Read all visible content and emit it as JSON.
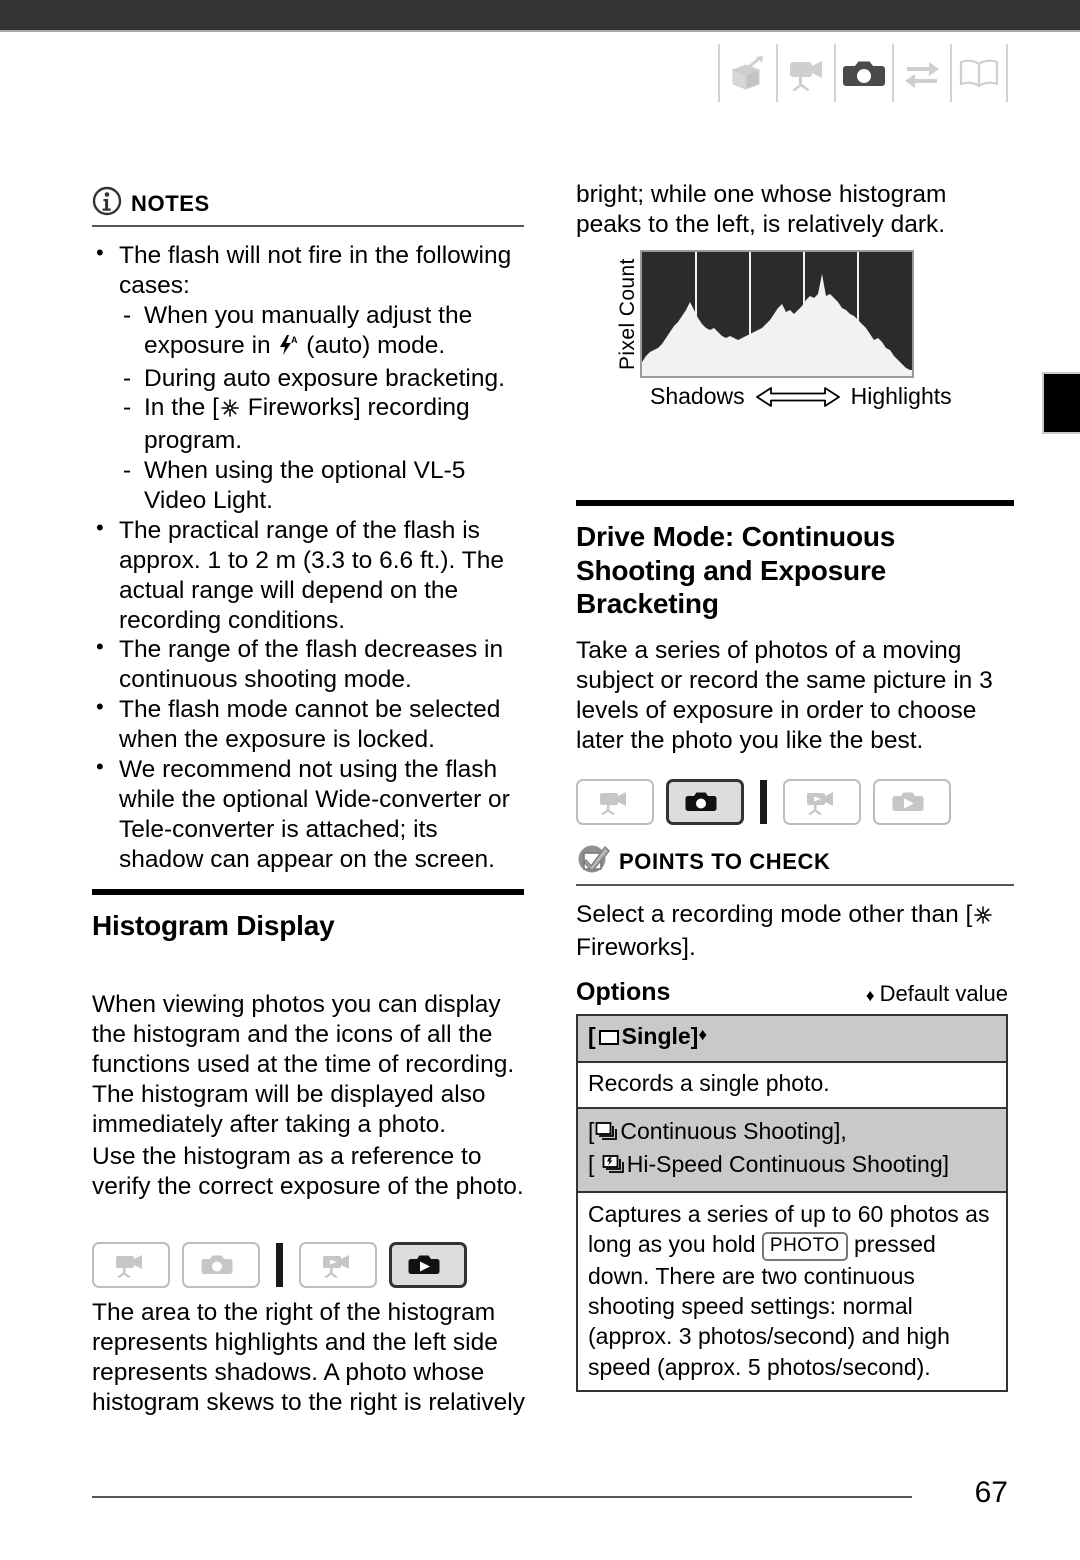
{
  "page": {
    "number": "67",
    "edge_tab": "chapter-tab-marker"
  },
  "header": {
    "icons": [
      {
        "name": "box-open-arrow-icon",
        "state": "inactive"
      },
      {
        "name": "video-camera-icon",
        "state": "inactive"
      },
      {
        "name": "photo-camera-icon",
        "state": "active"
      },
      {
        "name": "exchange-arrows-icon",
        "state": "inactive"
      },
      {
        "name": "open-book-icon",
        "state": "inactive"
      }
    ]
  },
  "left_column": {
    "notes": {
      "icon": "info-circle-icon",
      "title": "NOTES",
      "bullets": [
        {
          "text": "The flash will not fire in the following cases:",
          "sub": [
            {
              "pre": "When you manually adjust the exposure in ",
              "icon": "flash-auto-icon",
              "post": " (auto) mode."
            },
            {
              "pre": "During auto exposure bracketing.",
              "icon": "",
              "post": ""
            },
            {
              "pre": "In the [",
              "icon": "fireworks-icon",
              "post": " Fireworks] recording program."
            },
            {
              "pre": "When using the optional VL-5 Video Light.",
              "icon": "",
              "post": ""
            }
          ]
        },
        {
          "text": "The practical range of the flash is approx. 1 to 2 m (3.3 to 6.6 ft.). The actual range will depend on the recording conditions.",
          "sub": []
        },
        {
          "text": "The range of the flash decreases in continuous shooting mode.",
          "sub": []
        },
        {
          "text": "The flash mode cannot be selected when the exposure is locked.",
          "sub": []
        },
        {
          "text": "We recommend not using the flash while the optional Wide-converter or Tele-converter is attached; its shadow can appear on the screen.",
          "sub": []
        }
      ]
    },
    "histogram_section": {
      "title": "Histogram Display",
      "paragraph_1": "When viewing photos you can display the histogram and the icons of all the functions used at the time of recording. The histogram will be displayed also immediately after taking a photo.",
      "paragraph_2": "Use the histogram as a reference to verify the correct exposure of the photo.",
      "mode_buttons": [
        {
          "name": "movie-record-mode-button",
          "icon": "video-camera-icon",
          "active": false
        },
        {
          "name": "photo-record-mode-button",
          "icon": "photo-camera-icon",
          "active": false
        },
        {
          "name": "movie-playback-mode-button",
          "icon": "video-playback-icon",
          "active": false
        },
        {
          "name": "photo-playback-mode-button",
          "icon": "photo-playback-icon",
          "active": true
        }
      ],
      "paragraph_3": "The area to the right of the histogram represents highlights and the left side represents shadows. A photo whose histogram skews to the right is relatively"
    }
  },
  "right_column": {
    "continued_text": "bright; while one whose histogram peaks to the left, is relatively dark.",
    "histogram_figure": {
      "y_label": "Pixel Count",
      "left_label": "Shadows",
      "right_label": "Highlights",
      "arrow": "double-arrow-icon"
    },
    "drive_mode_section": {
      "title": "Drive Mode: Continuous Shooting and Exposure Bracketing",
      "intro": "Take a series of photos of a moving subject or record the same picture in 3 levels of exposure in order to choose later the photo you like the best.",
      "mode_buttons": [
        {
          "name": "movie-record-mode-button",
          "icon": "video-camera-icon",
          "active": false
        },
        {
          "name": "photo-record-mode-button",
          "icon": "photo-camera-icon",
          "active": true
        },
        {
          "name": "movie-playback-mode-button",
          "icon": "video-playback-icon",
          "active": false
        },
        {
          "name": "photo-playback-mode-button",
          "icon": "photo-playback-icon",
          "active": false
        }
      ],
      "points_to_check": {
        "icon": "checkbox-check-icon",
        "title": "POINTS TO CHECK",
        "text_pre": "Select a recording mode other than [",
        "text_icon": "fireworks-icon",
        "text_post": " Fireworks]."
      },
      "options": {
        "label": "Options",
        "default_marker": "♦",
        "default_text": "Default value",
        "rows": [
          {
            "header_pre": "[",
            "header_icon": "single-frame-icon",
            "header_text": "Single]",
            "header_marker": "♦",
            "body": "Records a single photo."
          },
          {
            "header_line_1_pre": "[",
            "header_line_1_icon": "continuous-shooting-icon",
            "header_line_1_text": "Continuous Shooting],",
            "header_line_2_pre": "[ ",
            "header_line_2_icon": "hispeed-continuous-shooting-icon",
            "header_line_2_text": "Hi-Speed Continuous Shooting]",
            "body_part_1": "Captures a series of up to 60 photos as long as you hold ",
            "body_key": "PHOTO",
            "body_part_2": " pressed down. There are two continuous shooting speed settings: normal (approx. 3 photos/second) and high speed (approx. 5 photos/second)."
          }
        ]
      }
    }
  }
}
